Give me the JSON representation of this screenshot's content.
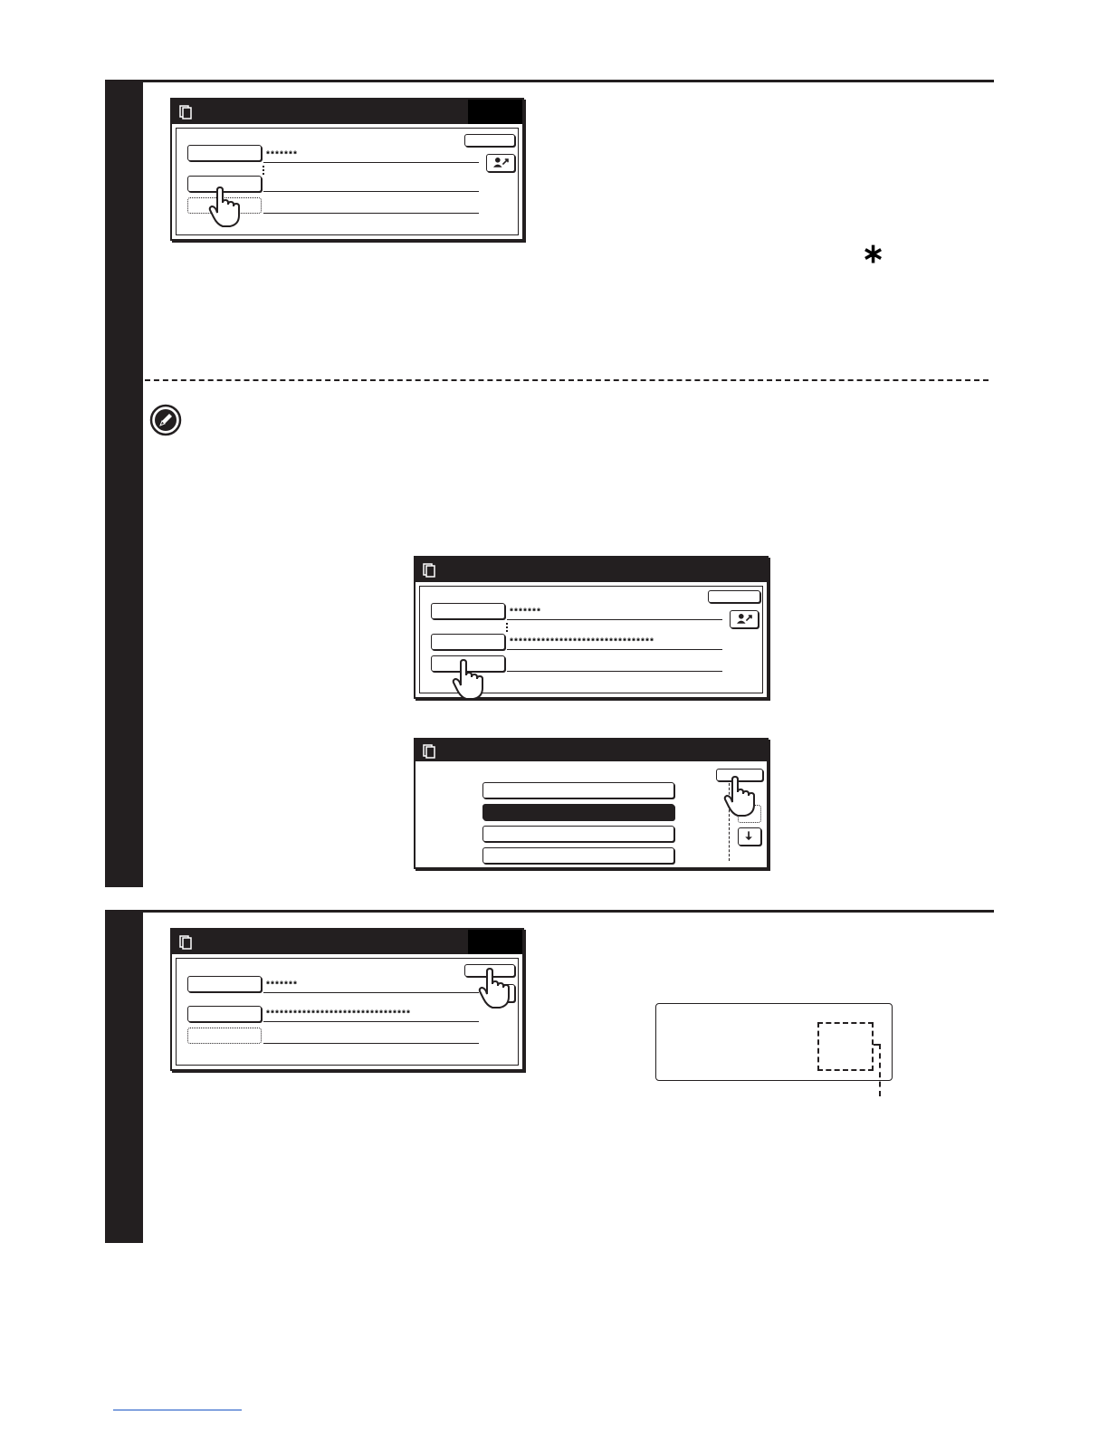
{
  "step1": {
    "screen": {
      "user_mask": "*******"
    },
    "asterisk_symbol": "∗"
  },
  "note": {
    "screen_a": {
      "user_mask": "*******",
      "password_mask": "********************************"
    }
  },
  "step2": {
    "screen": {
      "user_mask": "*******",
      "password_mask": "********************************"
    }
  }
}
